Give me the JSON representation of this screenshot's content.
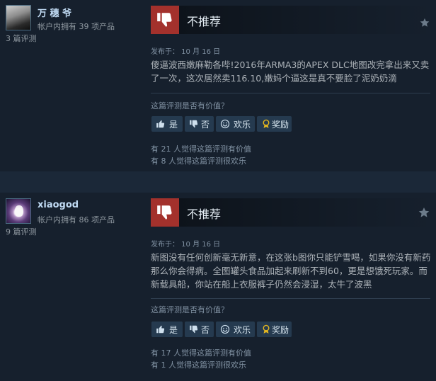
{
  "reviews": [
    {
      "username": "万 穗 爷",
      "products_owned": "帐户内拥有 39 项产品",
      "review_count": "3 篇评测",
      "verdict": "不推荐",
      "posted": "发布于： 10 月 16 日",
      "content": "傻逼波西嫩麻勒各哔!2016年ARMA3的APEX DLC地图改完拿出来又卖了一次，这次居然卖116.10,嫩妈个逼这是真不要脸了泥奶奶滴",
      "helpful_question": "这篇评测是否有价值？",
      "buttons": {
        "yes": "是",
        "no": "否",
        "funny": "欢乐",
        "award": "奖励"
      },
      "helpful_stat": "有 21 人觉得这篇评测有价值",
      "funny_stat": "有 8 人觉得这篇评测很欢乐"
    },
    {
      "username": "xiaogod",
      "products_owned": "帐户内拥有 86 项产品",
      "review_count": "9 篇评测",
      "verdict": "不推荐",
      "posted": "发布于： 10 月 16 日",
      "content": "新图没有任何创新毫无新意，在这张b图你只能铲雪喝，如果你没有新药那么你会得病。全图罐头食品加起来刷新不到60，更是想饿死玩家。而新载具船，你站在船上衣服裤子仍然会浸湿，太牛了波黑",
      "helpful_question": "这篇评测是否有价值？",
      "buttons": {
        "yes": "是",
        "no": "否",
        "funny": "欢乐",
        "award": "奖励"
      },
      "helpful_stat": "有 17 人觉得这篇评测有价值",
      "funny_stat": "有 1 人觉得这篇评测很欢乐"
    }
  ],
  "icons": [
    "thumbs-down-icon",
    "star-icon",
    "thumbs-up-icon",
    "smiley-icon",
    "award-icon"
  ],
  "colors": {
    "background": "#1b2838",
    "card": "#16202d",
    "thumb_down": "#a3312c",
    "button": "#253a4f",
    "award": "#e4b71f"
  }
}
